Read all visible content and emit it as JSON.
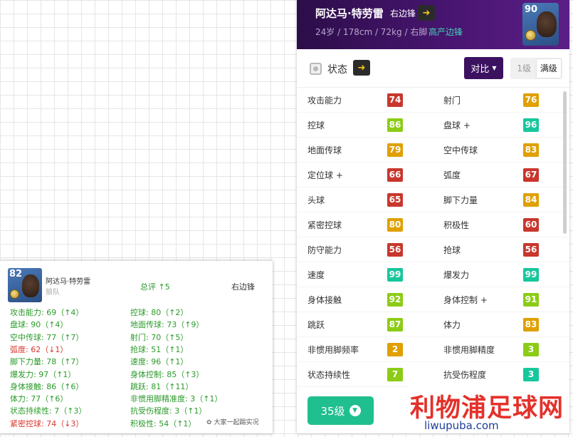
{
  "player": {
    "name": "阿达马·特劳雷",
    "position": "右边锋",
    "info": "24岁 / 178cm / 72kg / 右脚",
    "tag": "高产边锋",
    "rating": "90"
  },
  "toolbar": {
    "status_label": "状态",
    "compare_label": "对比",
    "level_1": "1级",
    "level_max": "满级"
  },
  "stats_rows": [
    {
      "l": {
        "name": "攻击能力",
        "value": "74",
        "color": "red"
      },
      "r": {
        "name": "射门",
        "value": "76",
        "color": "orange"
      }
    },
    {
      "l": {
        "name": "控球",
        "value": "86",
        "color": "lime"
      },
      "r": {
        "name": "盘球 +",
        "value": "96",
        "color": "teal"
      }
    },
    {
      "l": {
        "name": "地面传球",
        "value": "79",
        "color": "orange"
      },
      "r": {
        "name": "空中传球",
        "value": "83",
        "color": "orange"
      }
    },
    {
      "l": {
        "name": "定位球 +",
        "value": "66",
        "color": "red"
      },
      "r": {
        "name": "弧度",
        "value": "67",
        "color": "red"
      }
    },
    {
      "l": {
        "name": "头球",
        "value": "65",
        "color": "red"
      },
      "r": {
        "name": "脚下力量",
        "value": "84",
        "color": "orange"
      }
    },
    {
      "l": {
        "name": "紧密控球",
        "value": "80",
        "color": "orange"
      },
      "r": {
        "name": "积极性",
        "value": "60",
        "color": "red"
      }
    },
    {
      "l": {
        "name": "防守能力",
        "value": "56",
        "color": "red"
      },
      "r": {
        "name": "抢球",
        "value": "56",
        "color": "red"
      }
    },
    {
      "l": {
        "name": "速度",
        "value": "99",
        "color": "teal"
      },
      "r": {
        "name": "爆发力",
        "value": "99",
        "color": "teal"
      }
    },
    {
      "l": {
        "name": "身体接触",
        "value": "92",
        "color": "lime"
      },
      "r": {
        "name": "身体控制 +",
        "value": "91",
        "color": "lime"
      }
    },
    {
      "l": {
        "name": "跳跃",
        "value": "87",
        "color": "lime"
      },
      "r": {
        "name": "体力",
        "value": "83",
        "color": "orange"
      }
    },
    {
      "l": {
        "name": "非惯用脚频率",
        "value": "2",
        "color": "orange"
      },
      "r": {
        "name": "非惯用脚精度",
        "value": "3",
        "color": "lime"
      }
    },
    {
      "l": {
        "name": "状态持续性",
        "value": "7",
        "color": "lime"
      },
      "r": {
        "name": "抗受伤程度",
        "value": "3",
        "color": "teal"
      }
    }
  ],
  "level_button": "35级",
  "comparison": {
    "rating": "82",
    "name": "阿达马·特劳雷",
    "team": "狼队",
    "total": "总评 ↑5",
    "position": "右边锋",
    "left_lines": [
      {
        "text": "攻击能力: 69（↑4）",
        "tone": "g"
      },
      {
        "text": "盘球: 90（↑4）",
        "tone": "g"
      },
      {
        "text": "空中传球: 77（↑7）",
        "tone": "g"
      },
      {
        "text": "弧度: 62（↓1）",
        "tone": "rd"
      },
      {
        "text": "脚下力量: 78（↑7）",
        "tone": "g"
      },
      {
        "text": "爆发力: 97（↑1）",
        "tone": "g"
      },
      {
        "text": "身体接触: 86（↑6）",
        "tone": "g"
      },
      {
        "text": "体力: 77（↑6）",
        "tone": "g"
      },
      {
        "text": "状态持续性: 7（↑3）",
        "tone": "g"
      },
      {
        "text": "紧密控球: 74（↓3）",
        "tone": "rd"
      }
    ],
    "right_lines": [
      {
        "text": "控球: 80（↑2）",
        "tone": "g"
      },
      {
        "text": "地面传球: 73（↑9）",
        "tone": "g"
      },
      {
        "text": "射门: 70（↑5）",
        "tone": "g"
      },
      {
        "text": "抢球: 51（↑1）",
        "tone": "g"
      },
      {
        "text": "速度: 96（↑1）",
        "tone": "g"
      },
      {
        "text": "身体控制: 85（↑3）",
        "tone": "g"
      },
      {
        "text": "跳跃: 81（↑11）",
        "tone": "g"
      },
      {
        "text": "非惯用脚精准度: 3（↑1）",
        "tone": "g"
      },
      {
        "text": "抗受伤程度: 3（↑1）",
        "tone": "g"
      },
      {
        "text": "积极性: 54（↑1）",
        "tone": "g"
      }
    ],
    "watermark": "大家一起踢实况"
  },
  "banner": {
    "title": "利物浦足球网",
    "url": "liwupuba.com"
  },
  "colors": {
    "red": "#c8372d",
    "orange": "#e0a000",
    "lime": "#8ccc16",
    "teal": "#16c79c",
    "header_purple": "#4a1673",
    "accent_green": "#1fbf8f"
  }
}
